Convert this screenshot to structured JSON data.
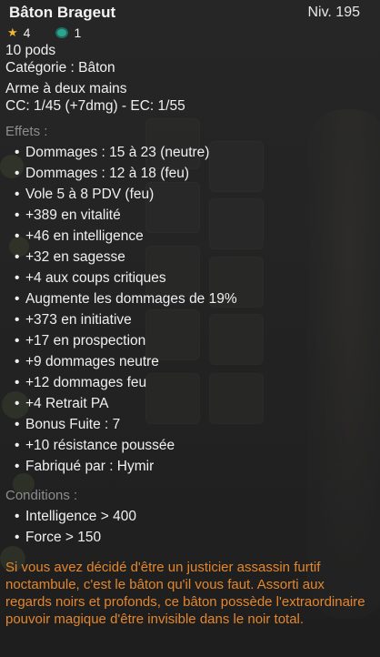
{
  "item": {
    "name": "Bâton Brageut",
    "level": "Niv. 195",
    "stars": "4",
    "eye_count": "1",
    "weight": "10 pods",
    "category": "Catégorie : Bâton",
    "hands": "Arme à deux mains",
    "crit": "CC: 1/45 (+7dmg) - EC: 1/55"
  },
  "effects": {
    "title": "Effets :",
    "items": [
      "Dommages : 15 à 23 (neutre)",
      "Dommages : 12 à 18 (feu)",
      "Vole 5 à 8 PDV (feu)",
      "+389 en vitalité",
      "+46 en intelligence",
      "+32 en sagesse",
      "+4 aux coups critiques",
      "Augmente les dommages de 19%",
      "+373 en initiative",
      "+17 en prospection",
      "+9 dommages neutre",
      "+12 dommages feu",
      "+4 Retrait PA",
      "Bonus Fuite : 7",
      "+10 résistance poussée",
      "Fabriqué par : Hymir"
    ]
  },
  "conditions": {
    "title": "Conditions :",
    "items": [
      "Intelligence > 400",
      "Force > 150"
    ]
  },
  "description": "Si vous avez décidé d'être un justicier assassin furtif noctambule, c'est le bâton qu'il vous faut. Assorti aux regards noirs et profonds, ce bâton possède l'extraordinaire pouvoir magique d'être invisible dans le noir total.",
  "colors": {
    "description": "#e3862d",
    "section_title": "#8d8d8d",
    "star": "#f0b531",
    "eye": "#2aa58e"
  },
  "icons": {
    "star": "star-icon",
    "eye": "eye-icon",
    "bullet": "•"
  }
}
